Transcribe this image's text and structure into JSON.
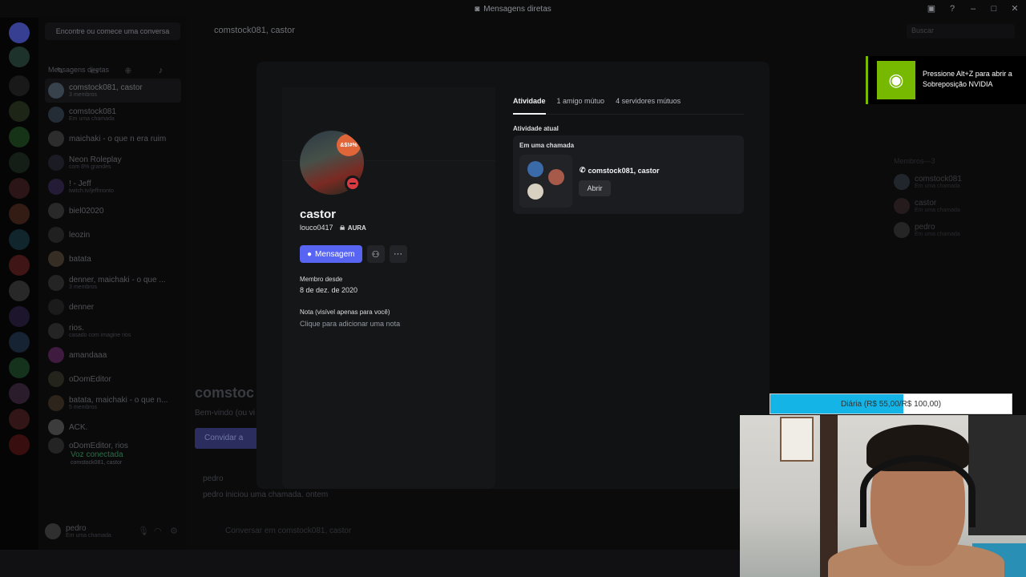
{
  "titlebar": {
    "title": "Mensagens diretas"
  },
  "search": {
    "placeholder": "Encontre ou comece uma conversa"
  },
  "sidebar": {
    "section_label": "Mensagens diretas",
    "dms": [
      {
        "name": "comstock081, castor",
        "sub": "3 membros",
        "active": true
      },
      {
        "name": "comstock081",
        "sub": "Em uma chamada"
      },
      {
        "name": "maichaki - o que n era ruim",
        "sub": ""
      },
      {
        "name": "Neon Roleplay",
        "sub": "com 8% grandes"
      },
      {
        "name": "! - Jeff",
        "sub": "twitch.tv/jeffmonto"
      },
      {
        "name": "biel02020",
        "sub": ""
      },
      {
        "name": "leozin",
        "sub": ""
      },
      {
        "name": "batata",
        "sub": ""
      },
      {
        "name": "denner, maichaki - o que ...",
        "sub": "3 membros"
      },
      {
        "name": "denner",
        "sub": ""
      },
      {
        "name": "rios.",
        "sub": "casado com imagine rios"
      },
      {
        "name": "amandaaa",
        "sub": ""
      },
      {
        "name": "oDomEditor",
        "sub": ""
      },
      {
        "name": "batata, maichaki - o que n...",
        "sub": "5 membros"
      },
      {
        "name": "ACK.",
        "sub": ""
      },
      {
        "name": "oDomEditor, rios",
        "sub": ""
      }
    ],
    "voice": {
      "title": "Voz conectada",
      "sub": "comstock081, castor"
    },
    "user": {
      "name": "pedro",
      "status": "Em uma chamada"
    }
  },
  "main": {
    "header_title": "comstock081, castor",
    "header_search": "Buscar",
    "big_title": "comstoc",
    "welcome": "Bem-vindo (ou vi",
    "invite": "Convidar a",
    "log": [
      {
        "user": "pedro",
        "text": ""
      },
      {
        "user": "pedro",
        "text": "iniciou uma chamada. ontem"
      }
    ],
    "input_placeholder": "Conversar em comstock081, castor",
    "members_label": "Membros—3",
    "members": [
      {
        "name": "comstock081",
        "sub": "Em uma chamada"
      },
      {
        "name": "castor",
        "sub": "Em uma chamada"
      },
      {
        "name": "pedro",
        "sub": "Em uma chamada"
      }
    ]
  },
  "profile": {
    "display_name": "castor",
    "username": "louco0417",
    "tag": "AURA",
    "avatar_emoji_text": "&$!#%",
    "message_button": "Mensagem",
    "member_since_label": "Membro desde",
    "member_since": "8 de dez. de 2020",
    "note_label": "Nota (visível apenas para você)",
    "note_placeholder": "Clique para adicionar uma nota",
    "tabs": [
      "Atividade",
      "1 amigo mútuo",
      "4 servidores mútuos"
    ],
    "activity_label": "Atividade atual",
    "activity_card_title": "Em uma chamada",
    "activity_call_name": "comstock081, castor",
    "open_button": "Abrir"
  },
  "nvidia": {
    "text": "Pressione Alt+Z para abrir a Sobreposição NVIDIA"
  },
  "goal": {
    "text": "Diária (R$ 55,00/R$ 100,00)",
    "progress": 0.55,
    "color": "#14b4e6"
  },
  "colors": {
    "brand": "#5865f2",
    "dnd": "#d83a42",
    "nvidia_green": "#76b900"
  }
}
